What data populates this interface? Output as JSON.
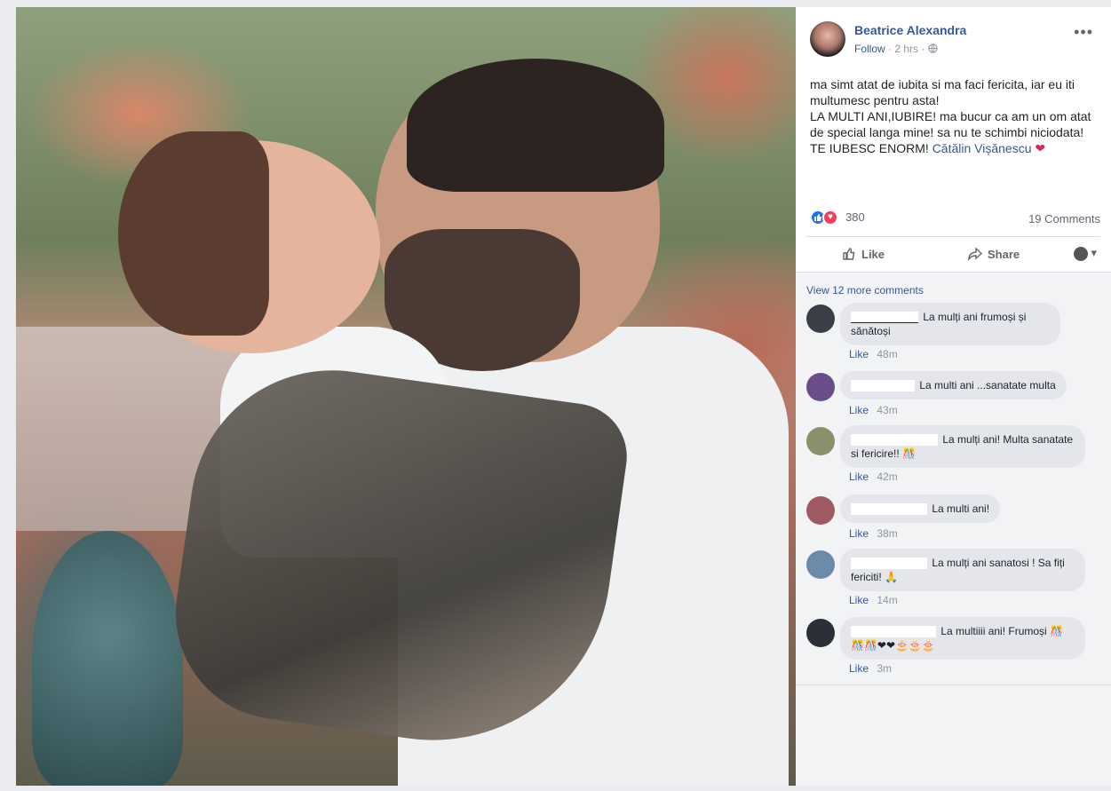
{
  "post": {
    "author": "Beatrice Alexandra",
    "follow": "Follow",
    "time": "2 hrs",
    "privacy_sep": "·",
    "more": "•••",
    "text_line1": "ma simt atat de iubita si ma faci fericita, iar eu iti multumesc pentru asta!",
    "text_line2": "LA MULTI ANI,IUBIRE! ma bucur ca am un om atat de special langa mine! sa nu te schimbi niciodata!",
    "text_line3": "TE IUBESC ENORM!",
    "tag": "Cătălin Vișănescu",
    "heart": "❤"
  },
  "reactions": {
    "count": "380",
    "comments": "19 Comments",
    "like_icon": "👍",
    "love_icon": "♥"
  },
  "actions": {
    "like": "Like",
    "share": "Share",
    "like_icon": "thumbs-up-icon",
    "share_icon": "share-arrow-icon",
    "audience_caret": "▾"
  },
  "comments": {
    "view_more": "View 12 more comments",
    "items": [
      {
        "text": "La mulți ani frumoși și sănătoși",
        "like": "Like",
        "time": "48m",
        "avatar_color": "#3a3f47"
      },
      {
        "text": "La multi ani ...sanatate multa",
        "like": "Like",
        "time": "43m",
        "avatar_color": "#6a4e8a"
      },
      {
        "text": "La mulți ani! Multa sanatate si fericire!!",
        "emoji": "🎊",
        "like": "Like",
        "time": "42m",
        "avatar_color": "#8b8f6a"
      },
      {
        "text": "La multi ani!",
        "like": "Like",
        "time": "38m",
        "avatar_color": "#a05b62"
      },
      {
        "text": "La mulți ani sanatosi ! Sa fiți fericiti!",
        "emoji": "🙏",
        "like": "Like",
        "time": "14m",
        "avatar_color": "#6d8aa8"
      },
      {
        "text": "La multiiii ani! Frumoși",
        "emoji": "🎊🎊🎊❤❤🎂🎂🎂",
        "like": "Like",
        "time": "3m",
        "avatar_color": "#2c2f38"
      }
    ]
  }
}
